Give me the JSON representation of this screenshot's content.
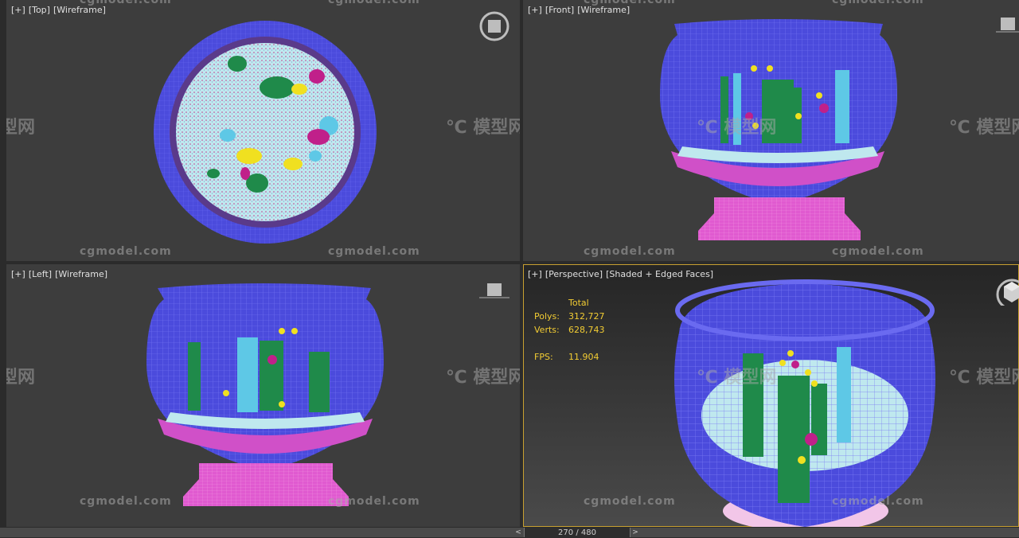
{
  "viewports": {
    "top": {
      "plus": "[+]",
      "view": "[Top]",
      "shading": "[Wireframe]"
    },
    "front": {
      "plus": "[+]",
      "view": "[Front]",
      "shading": "[Wireframe]"
    },
    "left": {
      "plus": "[+]",
      "view": "[Left]",
      "shading": "[Wireframe]"
    },
    "perspective": {
      "plus": "[+]",
      "view": "[Perspective]",
      "shading": "[Shaded + Edged Faces]"
    }
  },
  "stats": {
    "header": "Total",
    "polys_label": "Polys:",
    "polys": "312,727",
    "verts_label": "Verts:",
    "verts": "628,743",
    "fps_label": "FPS:",
    "fps": "11.904"
  },
  "watermark": {
    "site": "cgmodel.com",
    "logo": "模型网",
    "logo_partial": "型网"
  },
  "timeline": {
    "frame": "270 / 480",
    "prev": "<",
    "next": ">"
  },
  "colors": {
    "bowl": "#4b4bdc",
    "base": "#e05ad0",
    "sand": "#b9e6f0",
    "plant": "#1f8a4a",
    "coral": "#5ec8e6",
    "fish_yellow": "#f0e020",
    "fish_magenta": "#c0208a"
  }
}
